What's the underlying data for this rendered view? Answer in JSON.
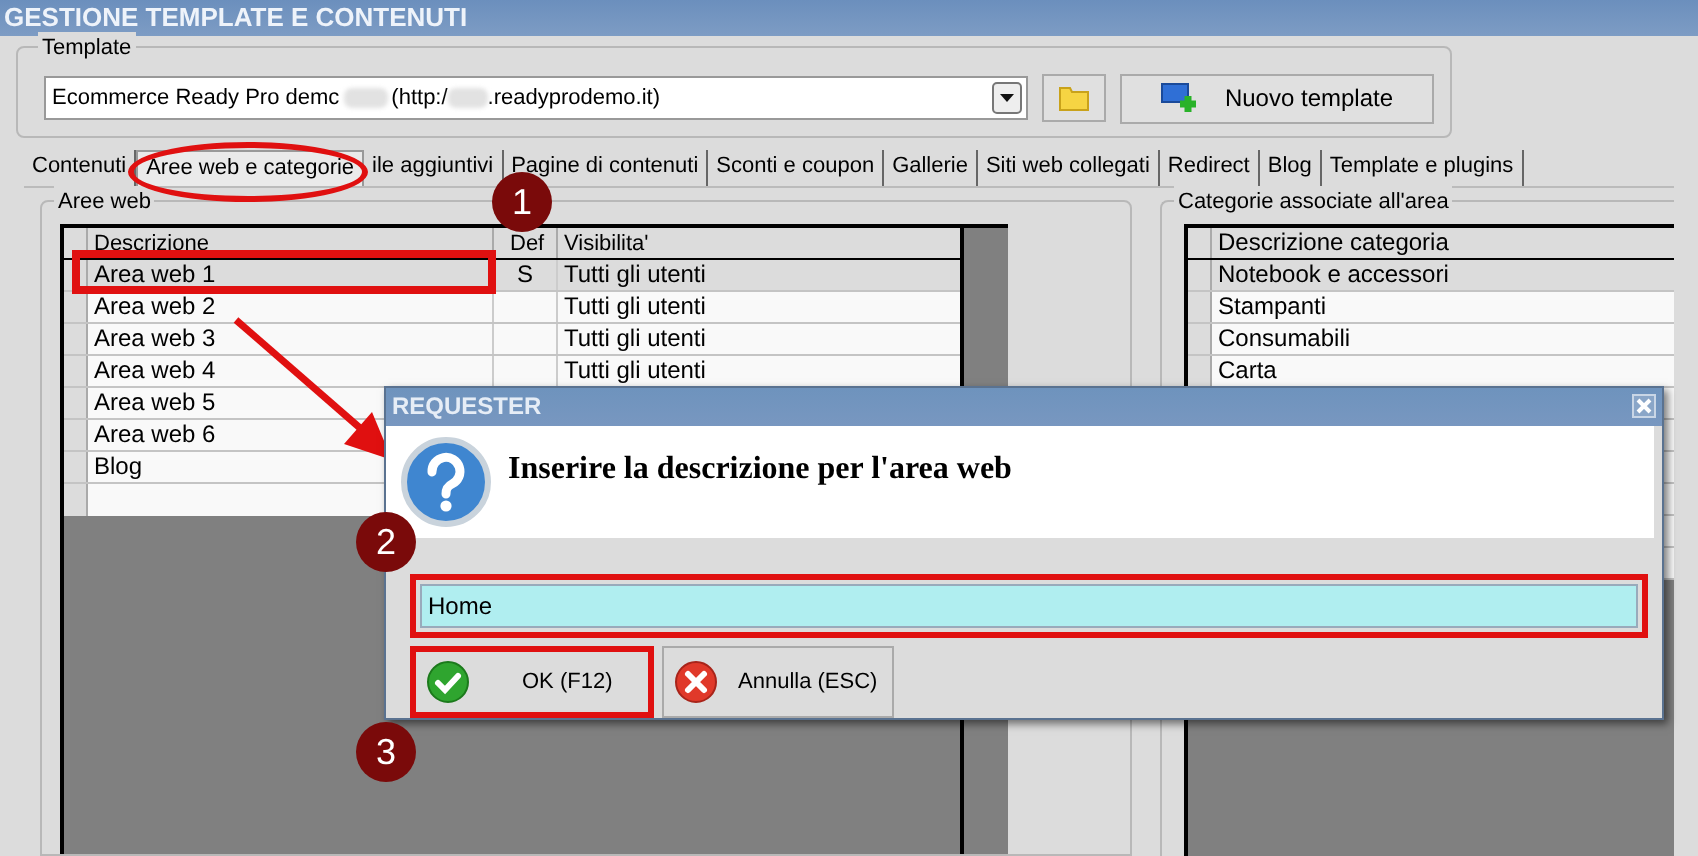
{
  "window": {
    "title": "GESTIONE TEMPLATE E CONTENUTI"
  },
  "template": {
    "legend": "Template",
    "value_parts": [
      "Ecommerce Ready Pro demc",
      "(http:/",
      ".readyprodemo.it)"
    ],
    "new_button": "Nuovo template"
  },
  "tabs": [
    {
      "label": "Contenuti",
      "selected": false
    },
    {
      "label": "Aree web e categorie",
      "selected": true
    },
    {
      "label": "ile aggiuntivi",
      "selected": false
    },
    {
      "label": "Pagine di contenuti",
      "selected": false
    },
    {
      "label": "Sconti e coupon",
      "selected": false
    },
    {
      "label": "Gallerie",
      "selected": false
    },
    {
      "label": "Siti web collegati",
      "selected": false
    },
    {
      "label": "Redirect",
      "selected": false
    },
    {
      "label": "Blog",
      "selected": false
    },
    {
      "label": "Template e plugins",
      "selected": false
    }
  ],
  "areas_panel": {
    "legend": "Aree web",
    "columns": [
      "Descrizione",
      "Def",
      "Visibilita'"
    ],
    "rows": [
      {
        "description": "Area web 1",
        "default": "S",
        "visibility": "Tutti gli utenti",
        "selected": true
      },
      {
        "description": "Area web 2",
        "visibility": "Tutti gli utenti",
        "selected": false
      },
      {
        "description": "Area web 3",
        "visibility": "Tutti gli utenti",
        "selected": false
      },
      {
        "description": "Area web 4",
        "visibility": "Tutti gli utenti",
        "selected": false
      },
      {
        "description": "Area web 5",
        "selected": false
      },
      {
        "description": "Area web 6",
        "selected": false
      },
      {
        "description": "Blog",
        "selected": false
      }
    ]
  },
  "categories_panel": {
    "legend": "Categorie associate all'area",
    "column": "Descrizione categoria",
    "rows": [
      {
        "name": "Notebook e accessori",
        "selected": true
      },
      {
        "name": "Stampanti",
        "selected": false
      },
      {
        "name": "Consumabili",
        "selected": false
      },
      {
        "name": "Carta",
        "selected": false
      }
    ]
  },
  "dialog": {
    "title": "REQUESTER",
    "message": "Inserire la descrizione per l'area web",
    "value": "Home",
    "buttons": [
      {
        "label": "OK (F12)",
        "kind": "ok"
      },
      {
        "label": "Annulla (ESC)",
        "kind": "cancel"
      }
    ]
  },
  "annotations": [
    "1",
    "2",
    "3"
  ]
}
